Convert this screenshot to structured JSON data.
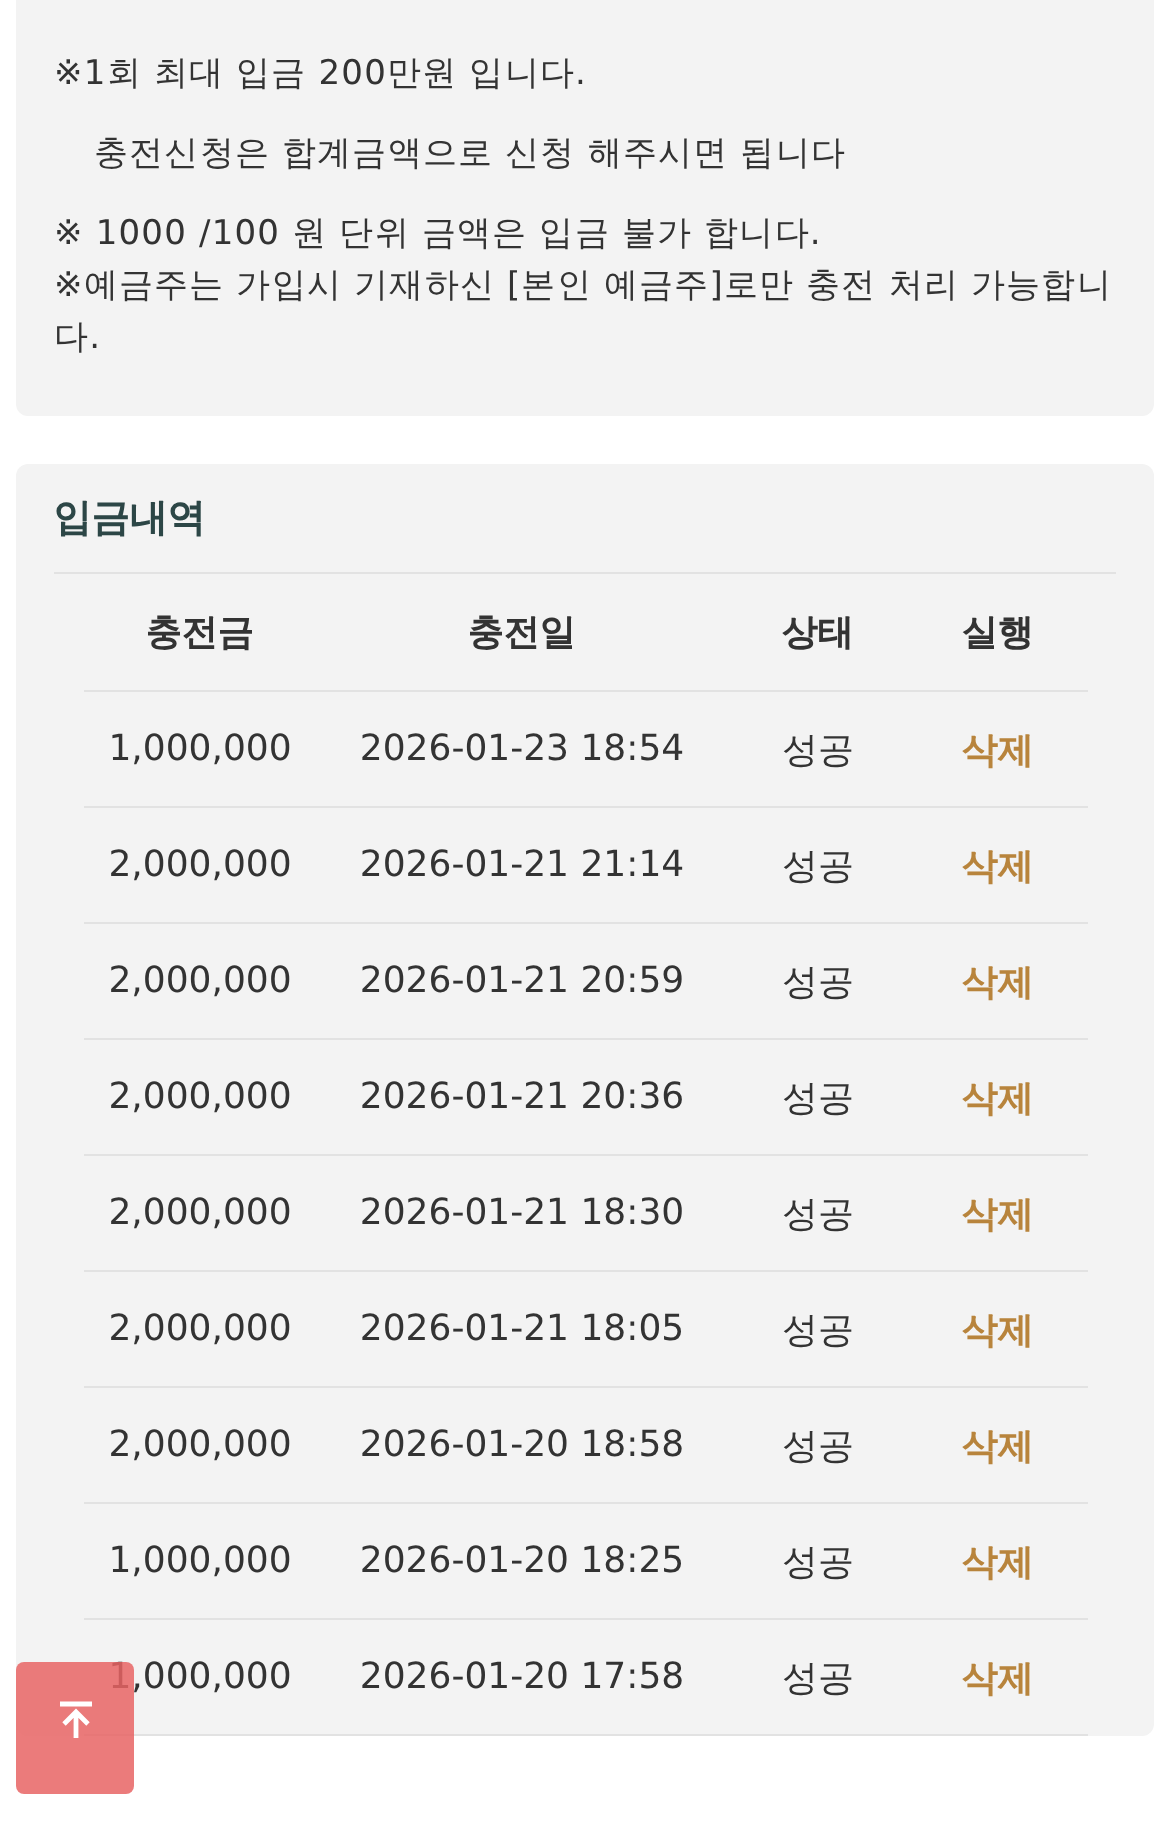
{
  "notices": [
    {
      "text": "※1회 최대 입금 200만원 입니다.",
      "indent": false
    },
    {
      "text": "충전신청은 합계금액으로 신청 해주시면 됩니다",
      "indent": true
    },
    {
      "text": "※ 1000 /100 원 단위 금액은 입금 불가 합니다.\n※예금주는 가입시 기재하신 [본인 예금주]로만 충전 처리 가능합니다.",
      "indent": false
    }
  ],
  "history": {
    "title": "입금내역",
    "columns": [
      "충전금",
      "충전일",
      "상태",
      "실행"
    ],
    "rows": [
      {
        "amount": "1,000,000",
        "date": "2026-01-23 18:54",
        "status": "성공",
        "action": "삭제"
      },
      {
        "amount": "2,000,000",
        "date": "2026-01-21 21:14",
        "status": "성공",
        "action": "삭제"
      },
      {
        "amount": "2,000,000",
        "date": "2026-01-21 20:59",
        "status": "성공",
        "action": "삭제"
      },
      {
        "amount": "2,000,000",
        "date": "2026-01-21 20:36",
        "status": "성공",
        "action": "삭제"
      },
      {
        "amount": "2,000,000",
        "date": "2026-01-21 18:30",
        "status": "성공",
        "action": "삭제"
      },
      {
        "amount": "2,000,000",
        "date": "2026-01-21 18:05",
        "status": "성공",
        "action": "삭제"
      },
      {
        "amount": "2,000,000",
        "date": "2026-01-20 18:58",
        "status": "성공",
        "action": "삭제"
      },
      {
        "amount": "1,000,000",
        "date": "2026-01-20 18:25",
        "status": "성공",
        "action": "삭제"
      },
      {
        "amount": "1,000,000",
        "date": "2026-01-20 17:58",
        "status": "성공",
        "action": "삭제"
      }
    ]
  }
}
